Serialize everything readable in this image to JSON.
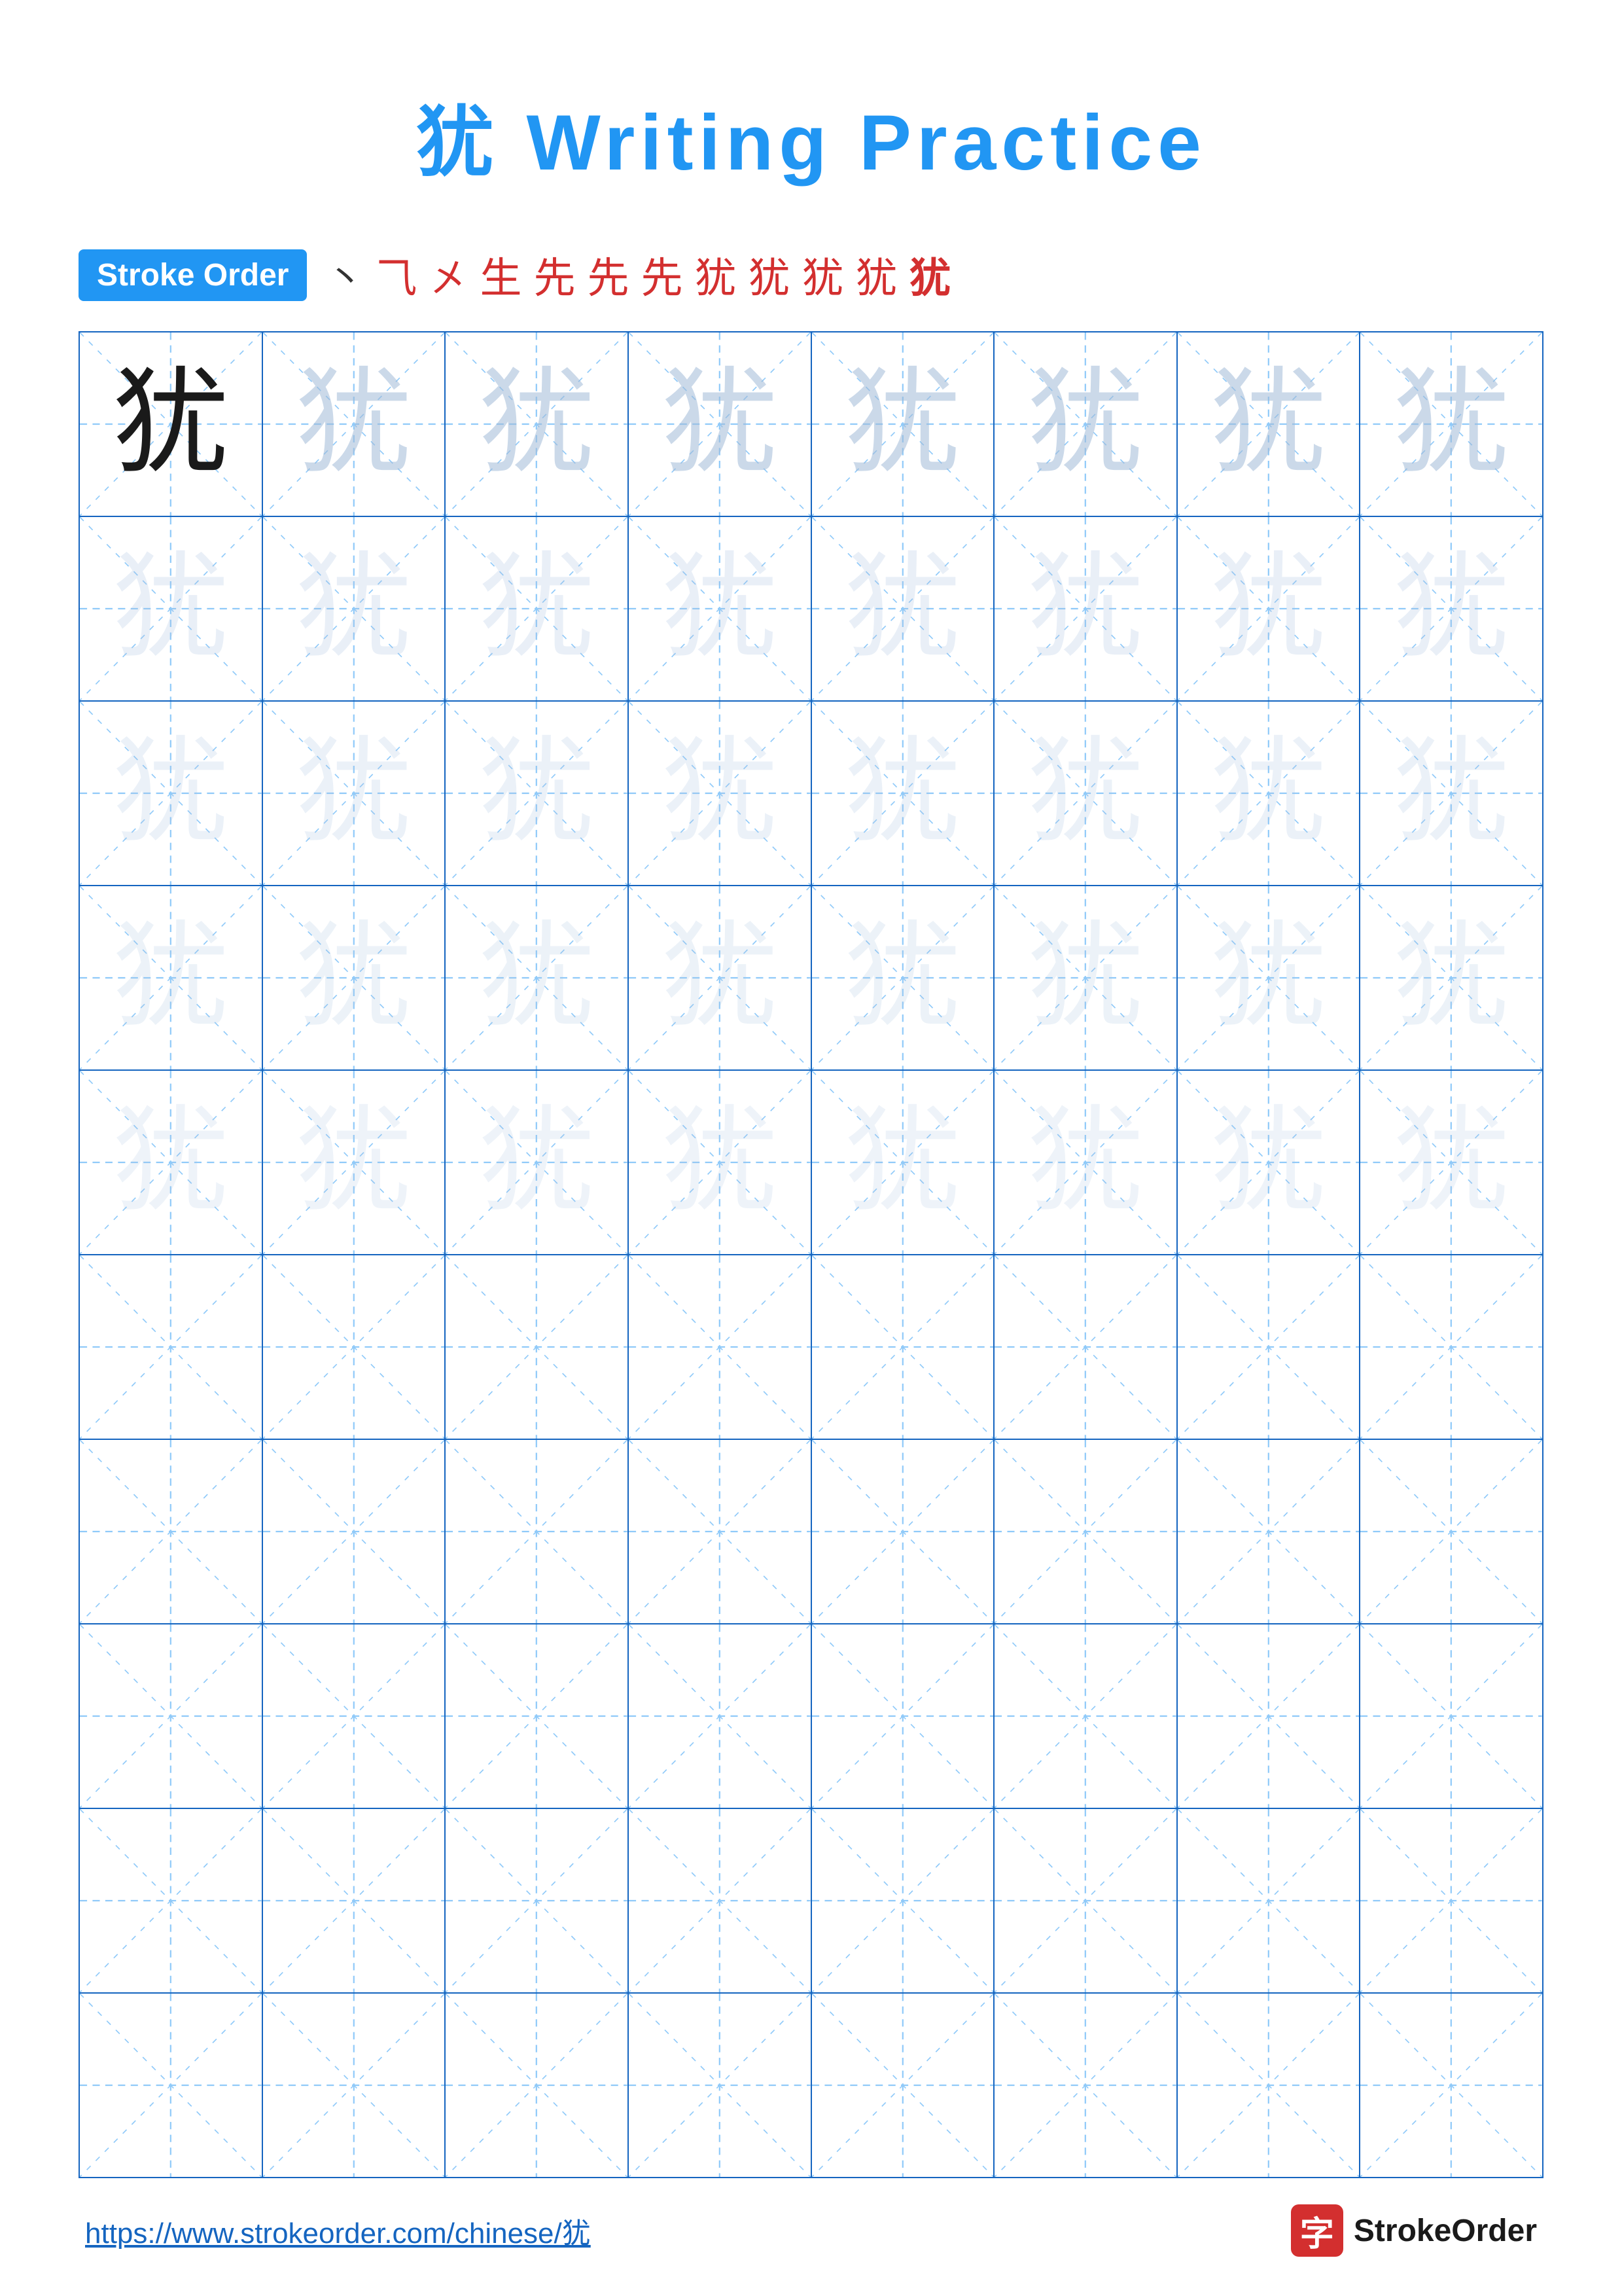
{
  "page": {
    "title": "犹 Writing Practice",
    "title_char": "犹",
    "title_text": "Writing Practice"
  },
  "stroke_order": {
    "badge_label": "Stroke Order",
    "strokes": [
      "'",
      "ㄴ",
      "㐅",
      "生",
      "𠂉",
      "先",
      "先",
      "先",
      "犹",
      "犹",
      "犹",
      "犹"
    ]
  },
  "grid": {
    "rows": 10,
    "cols": 8,
    "char": "犹"
  },
  "footer": {
    "url": "https://www.strokeorder.com/chinese/犹",
    "logo_char": "字",
    "logo_text": "StrokeOrder"
  }
}
